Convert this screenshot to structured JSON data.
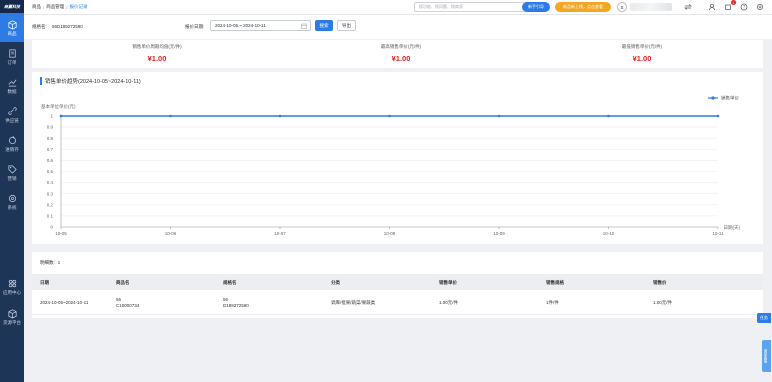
{
  "sidebar": {
    "logo": "商赢科技",
    "items": [
      {
        "label": "商品",
        "icon": "box-icon",
        "active": true
      },
      {
        "label": "订单",
        "icon": "order-icon",
        "active": false
      },
      {
        "label": "数据",
        "icon": "chart-icon",
        "active": false
      },
      {
        "label": "供应链",
        "icon": "link-icon",
        "active": false
      },
      {
        "label": "进销存",
        "icon": "cycle-icon",
        "active": false
      },
      {
        "label": "营销",
        "icon": "tag-icon",
        "active": false
      },
      {
        "label": "系统",
        "icon": "gear-icon",
        "active": false
      }
    ],
    "bottom_items": [
      {
        "label": "应用中心",
        "icon": "apps-icon"
      },
      {
        "label": "货源平台",
        "icon": "cube-icon"
      }
    ]
  },
  "topbar": {
    "breadcrumb": [
      "商品",
      "商品管理",
      "报价记录"
    ],
    "search_placeholder": "搜功能、搜问题、搜商家",
    "new_user_button": "新手引导",
    "promo_button": "新品新上线，点击查看",
    "avatar_initial": "S",
    "notification_count": "1"
  },
  "filter": {
    "spec_label": "规格名:",
    "spec_value": "56D189272590",
    "date_label": "报价日期:",
    "date_value": "2024-10-05 ~ 2024-10-11",
    "search_button": "搜索",
    "export_button": "导出"
  },
  "stats": [
    {
      "label": "销售单价周期均值(元/件)",
      "value": "¥1.00"
    },
    {
      "label": "最高销售单价(元/件)",
      "value": "¥1.00"
    },
    {
      "label": "最低销售单价(元/件)",
      "value": "¥1.00"
    }
  ],
  "chart_data": {
    "type": "line",
    "title": "销售单价趋势(2024-10-05~2024-10-11)",
    "ylabel": "基本单位单价(元)",
    "xlabel": "日期(天)",
    "categories": [
      "10-05",
      "10-06",
      "10-07",
      "10-08",
      "10-09",
      "10-10",
      "10-11"
    ],
    "series": [
      {
        "name": "销售单价",
        "values": [
          1,
          1,
          1,
          1,
          1,
          1,
          1
        ]
      }
    ],
    "ylim": [
      0,
      1
    ],
    "yticks": [
      "0",
      "0.1",
      "0.2",
      "0.3",
      "0.4",
      "0.5",
      "0.6",
      "0.7",
      "0.8",
      "0.9",
      "1"
    ],
    "legend": "top-right",
    "color": "#2d7be5"
  },
  "table": {
    "count_label": "明细数:",
    "count_value": "1",
    "headers": [
      "日期",
      "商品名",
      "规格名",
      "分类",
      "销售单价",
      "销售规格",
      "销售价"
    ],
    "rows": [
      {
        "date": "2024-10-05~2024-10-11",
        "product_line1": "56",
        "product_line2": "C10000734",
        "spec_line1": "56",
        "spec_line2": "D189272590",
        "category": "调库/批果/蔬菜/果蔬类",
        "unit_price": "1.00元/件",
        "sale_spec": "1件/件",
        "price": "1.00元/件"
      }
    ]
  },
  "floats": {
    "side_tab": "任务",
    "side_tab2": "商家客服"
  }
}
